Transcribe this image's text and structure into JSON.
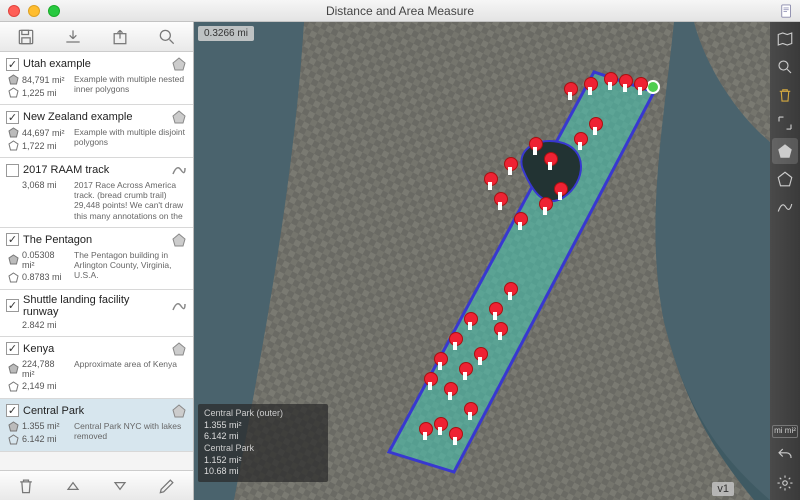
{
  "window": {
    "title": "Distance and Area Measure"
  },
  "sidebar": {
    "topToolbar": [
      "save-icon",
      "import-icon",
      "export-icon",
      "search-icon"
    ],
    "items": [
      {
        "checked": true,
        "title": "Utah example",
        "area": "84,791 mi²",
        "perim": "1,225 mi",
        "desc": "Example with multiple nested inner polygons",
        "shape": "polygon"
      },
      {
        "checked": true,
        "title": "New Zealand example",
        "area": "44,697 mi²",
        "perim": "1,722 mi",
        "desc": "Example with multiple disjoint polygons",
        "shape": "polygon"
      },
      {
        "checked": false,
        "title": "2017 RAAM track",
        "area": "",
        "perim": "3,068 mi",
        "desc": "2017 Race Across America track. (bread crumb trail) 29,448 points! We can't draw this many annotations on the",
        "shape": "track"
      },
      {
        "checked": true,
        "title": "The Pentagon",
        "area": "0.05308 mi²",
        "perim": "0.8783 mi",
        "desc": "The Pentagon building in Arlington County, Virginia, U.S.A.",
        "shape": "polygon"
      },
      {
        "checked": true,
        "title": "Shuttle landing facility runway",
        "area": "",
        "perim": "2.842 mi",
        "desc": "",
        "shape": "track"
      },
      {
        "checked": true,
        "title": "Kenya",
        "area": "224,788 mi²",
        "perim": "2,149 mi",
        "desc": "Approximate area of Kenya",
        "shape": "polygon"
      },
      {
        "checked": true,
        "title": "Central Park",
        "area": "1.355 mi²",
        "perim": "6.142 mi",
        "desc": "Central Park NYC with lakes removed",
        "shape": "polygon",
        "selected": true
      }
    ],
    "footerToolbar": [
      "trash-icon",
      "up-icon",
      "down-icon",
      "edit-icon"
    ]
  },
  "map": {
    "scale": "0.3266 mi",
    "infoPanel": [
      {
        "header": "Central Park (outer)",
        "area": "1.355 mi²",
        "perim": "6.142 mi"
      },
      {
        "header": "Central Park",
        "area": "1.152 mi²",
        "perim": "10.68 mi"
      }
    ],
    "version": "v1"
  },
  "rightToolbar": {
    "buttons": [
      "map-type-icon",
      "search-icon",
      "trash-icon",
      "expand-icon",
      "polygon-tool-icon",
      "circle-tool-icon",
      "track-tool-icon",
      "undo-icon",
      "settings-icon"
    ],
    "unitLabel": "mi mi²"
  }
}
